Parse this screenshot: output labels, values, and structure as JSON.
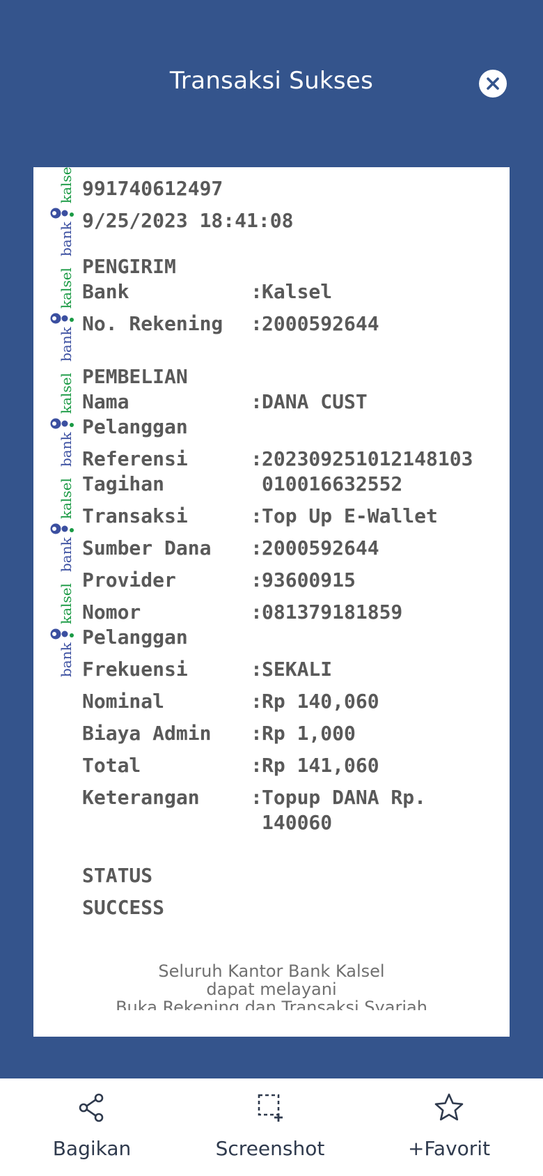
{
  "header": {
    "title": "Transaksi Sukses",
    "close_icon": "close-icon"
  },
  "watermark": {
    "brand_bank": "bank",
    "brand_kalsel": "kalsel",
    "colors": {
      "bank": "#3b4fa0",
      "kalsel": "#1a9a44"
    }
  },
  "receipt": {
    "ref_no": "991740612497",
    "datetime": "9/25/2023 18:41:08",
    "sender_heading": "PENGIRIM",
    "sender": [
      {
        "label": "Bank",
        "value": "Kalsel"
      },
      {
        "label": "No. Rekening",
        "value": "2000592644"
      }
    ],
    "purchase_heading": "PEMBELIAN",
    "purchase": [
      {
        "label": "Nama",
        "label2": "Pelanggan",
        "value": "DANA CUST",
        "value2": ""
      },
      {
        "label": "Referensi",
        "label2": "Tagihan",
        "value": "20230925101214810​3",
        "value2": "010016632552"
      },
      {
        "label": "Transaksi",
        "value": "Top Up E-Wallet"
      },
      {
        "label": "Sumber Dana",
        "value": "2000592644"
      },
      {
        "label": "Provider",
        "value": "93600915"
      },
      {
        "label": "Nomor",
        "label2": "Pelanggan",
        "value": "081379181859"
      },
      {
        "label": "Frekuensi",
        "value": "SEKALI"
      },
      {
        "label": "Nominal",
        "value": "Rp 140,060"
      },
      {
        "label": "Biaya Admin",
        "value": "Rp 1,000"
      },
      {
        "label": "Total",
        "value": "Rp 141,060"
      },
      {
        "label": "Keterangan",
        "value": "Topup DANA Rp.",
        "value2": "140060"
      }
    ],
    "colon": ":",
    "status_heading": "STATUS",
    "status_value": "SUCCESS",
    "footer_line1": "Seluruh Kantor Bank Kalsel",
    "footer_line2": "dapat melayani",
    "footer_line3": "Buka Rekening dan Transaksi Syariah"
  },
  "bottom_bar": {
    "share": {
      "label": "Bagikan",
      "icon": "share-icon"
    },
    "screenshot": {
      "label": "Screenshot",
      "icon": "screenshot-icon"
    },
    "favorite": {
      "label": "+Favorit",
      "icon": "star-icon"
    }
  }
}
